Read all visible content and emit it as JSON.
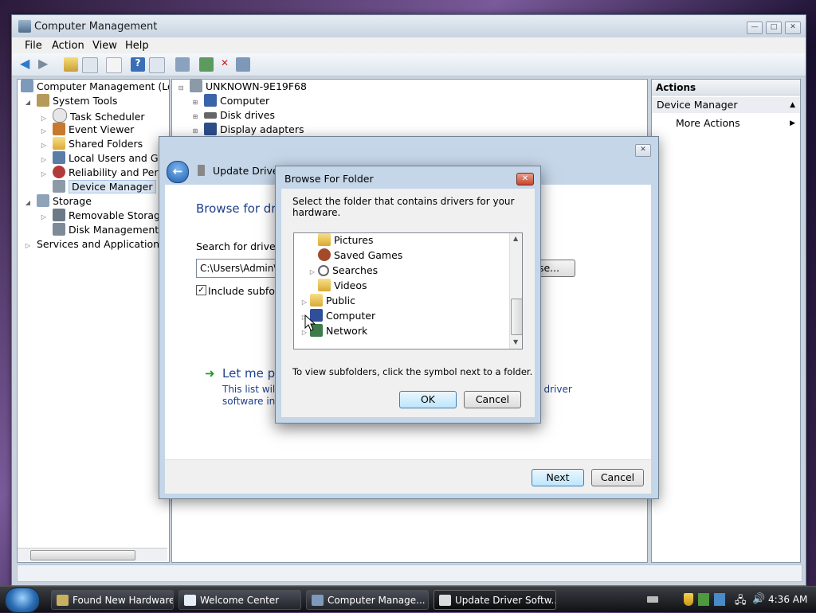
{
  "main_window": {
    "title": "Computer Management",
    "menu": [
      "File",
      "Action",
      "View",
      "Help"
    ],
    "left_tree": [
      {
        "label": "Computer Management (Local",
        "level": 0
      },
      {
        "label": "System Tools",
        "level": 1
      },
      {
        "label": "Task Scheduler",
        "level": 2
      },
      {
        "label": "Event Viewer",
        "level": 2
      },
      {
        "label": "Shared Folders",
        "level": 2
      },
      {
        "label": "Local Users and Group",
        "level": 2
      },
      {
        "label": "Reliability and Perform",
        "level": 2
      },
      {
        "label": "Device Manager",
        "level": 2,
        "selected": true
      },
      {
        "label": "Storage",
        "level": 1
      },
      {
        "label": "Removable Storage",
        "level": 2
      },
      {
        "label": "Disk Management",
        "level": 2
      },
      {
        "label": "Services and Applications",
        "level": 1
      }
    ],
    "device_tree": {
      "root": "UNKNOWN-9E19F68",
      "items": [
        "Computer",
        "Disk drives",
        "Display adapters"
      ]
    },
    "actions_panel": {
      "header": "Actions",
      "section": "Device Manager",
      "more": "More Actions"
    }
  },
  "wizard": {
    "title": "Update Driver S",
    "heading": "Browse for driv",
    "search_label": "Search for driver so",
    "path_value": "C:\\Users\\Admin\\D",
    "browse_label": "se...",
    "include_subfolders": "Include subfolde",
    "let_me_pick": "Let me pic",
    "desc_line1": "This list will s",
    "desc_line2": "software in th",
    "desc_tail": "ll driver",
    "next": "Next",
    "cancel": "Cancel"
  },
  "browse_dialog": {
    "title": "Browse For Folder",
    "instruction": "Select the folder that contains drivers for your hardware.",
    "folders": [
      {
        "label": "Pictures",
        "icon": "folder-icon",
        "indent": 2
      },
      {
        "label": "Saved Games",
        "icon": "games-icon",
        "indent": 2
      },
      {
        "label": "Searches",
        "icon": "search-icon",
        "indent": 2,
        "expandable": true
      },
      {
        "label": "Videos",
        "icon": "folder-icon",
        "indent": 2
      },
      {
        "label": "Public",
        "icon": "folder-icon",
        "indent": 1,
        "expandable": true
      },
      {
        "label": "Computer",
        "icon": "computer-icon",
        "indent": 1,
        "expandable": true
      },
      {
        "label": "Network",
        "icon": "network-icon",
        "indent": 1,
        "expandable": true
      }
    ],
    "hint": "To view subfolders, click the symbol next to a folder.",
    "ok": "OK",
    "cancel": "Cancel"
  },
  "taskbar": {
    "tasks": [
      {
        "label": "Found New Hardware"
      },
      {
        "label": "Welcome Center"
      },
      {
        "label": "Computer Manage..."
      },
      {
        "label": "Update Driver Softw...",
        "active": true
      }
    ],
    "clock": "4:36 AM"
  }
}
